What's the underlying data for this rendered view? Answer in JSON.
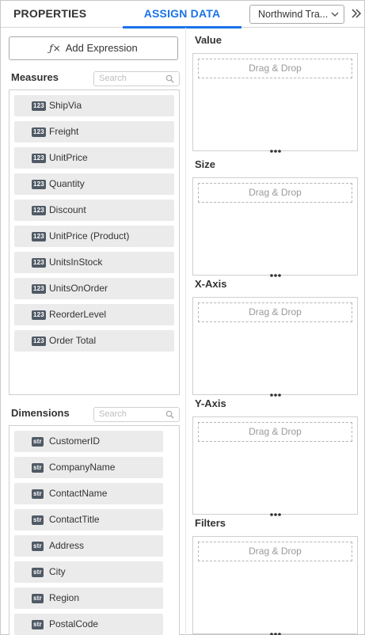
{
  "header": {
    "tabs": [
      {
        "label": "PROPERTIES"
      },
      {
        "label": "ASSIGN DATA"
      }
    ],
    "datasource_value": "Northwind Tra...",
    "active_tab_color": "#1a73e8"
  },
  "add_expression_label": "Add Expression",
  "measures": {
    "title": "Measures",
    "search_placeholder": "Search",
    "type_badge": "123",
    "items": [
      "ShipVia",
      "Freight",
      "UnitPrice",
      "Quantity",
      "Discount",
      "UnitPrice (Product)",
      "UnitsInStock",
      "UnitsOnOrder",
      "ReorderLevel",
      "Order Total"
    ]
  },
  "dimensions": {
    "title": "Dimensions",
    "search_placeholder": "Search",
    "type_badge": "str",
    "items": [
      "CustomerID",
      "CompanyName",
      "ContactName",
      "ContactTitle",
      "Address",
      "City",
      "Region",
      "PostalCode"
    ]
  },
  "drop_zones": [
    {
      "label": "Value",
      "placeholder": "Drag & Drop"
    },
    {
      "label": "Size",
      "placeholder": "Drag & Drop"
    },
    {
      "label": "X-Axis",
      "placeholder": "Drag & Drop"
    },
    {
      "label": "Y-Axis",
      "placeholder": "Drag & Drop"
    },
    {
      "label": "Filters",
      "placeholder": "Drag & Drop"
    }
  ]
}
